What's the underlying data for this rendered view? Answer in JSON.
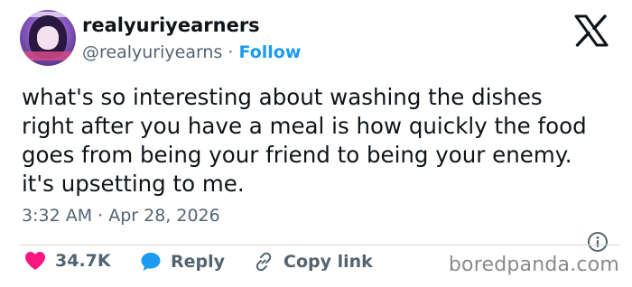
{
  "author": {
    "display_name": "realyuriyearners",
    "handle": "@realyuriyearns",
    "separator": " · ",
    "follow_label": "Follow"
  },
  "tweet": {
    "text": "what's so interesting about washing the dishes\nright after you have a meal is how quickly the food\ngoes from being your friend to being your enemy.\nit's upsetting to me.",
    "timestamp": "3:32 AM · Apr 28, 2026"
  },
  "actions": {
    "likes_count": "34.7K",
    "reply_label": "Reply",
    "copy_link_label": "Copy link"
  },
  "icons": {
    "logo": "x-logo-icon",
    "info": "info-icon",
    "like": "heart-icon",
    "reply": "speech-bubble-icon",
    "copy": "link-icon"
  },
  "colors": {
    "accent": "#1d9bf0",
    "like": "#f91880",
    "text": "#0f1419",
    "muted": "#536471"
  },
  "watermark": "boredpanda.com"
}
